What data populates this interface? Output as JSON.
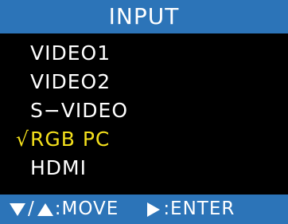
{
  "header": {
    "title": "INPUT"
  },
  "menu": {
    "selected_marker": "√",
    "items": [
      {
        "label": "VIDEO1",
        "selected": false
      },
      {
        "label": "VIDEO2",
        "selected": false
      },
      {
        "label": "S−VIDEO",
        "selected": false
      },
      {
        "label": "RGB PC",
        "selected": true
      },
      {
        "label": "HDMI",
        "selected": false
      }
    ]
  },
  "footer": {
    "move_separator": "/",
    "move_label": ":MOVE",
    "enter_label": ":ENTER",
    "icons": [
      "triangle-down-icon",
      "triangle-up-icon",
      "triangle-right-icon"
    ]
  },
  "colors": {
    "bar_background": "#2c74b8",
    "menu_background": "#000000",
    "text": "#ffffff",
    "selected_text": "#f4e01c"
  }
}
